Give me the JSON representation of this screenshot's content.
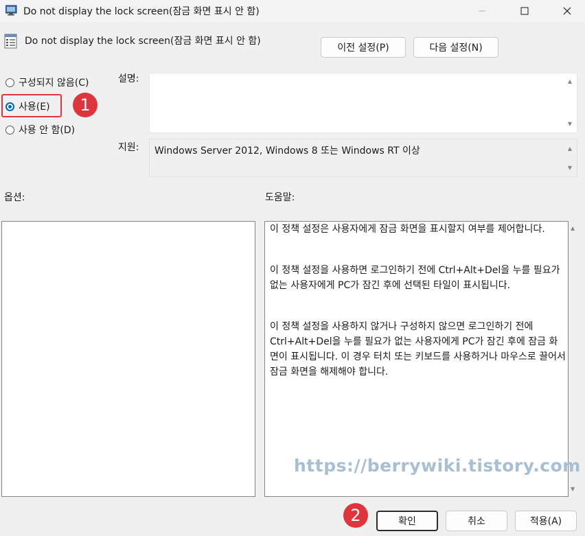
{
  "window": {
    "title": "Do not display the lock screen(잠금 화면 표시 안 함)",
    "controls": [
      "minimize-icon",
      "maximize-icon",
      "close-icon"
    ]
  },
  "header": {
    "policy_name": "Do not display the lock screen(잠금 화면 표시 안 함)",
    "prev_button": "이전 설정(P)",
    "next_button": "다음 설정(N)"
  },
  "state": {
    "options": [
      {
        "label": "구성되지 않음(C)",
        "checked": false
      },
      {
        "label": "사용(E)",
        "checked": true
      },
      {
        "label": "사용 안 함(D)",
        "checked": false
      }
    ]
  },
  "comment": {
    "label": "설명:",
    "value": ""
  },
  "support": {
    "label": "지원:",
    "value": "Windows Server 2012, Windows 8 또는 Windows RT 이상"
  },
  "options_pane": {
    "label": "옵션:"
  },
  "help_pane": {
    "label": "도움말:",
    "paragraphs": [
      "이 정책 설정은 사용자에게 잠금 화면을 표시할지 여부를 제어합니다.",
      "이 정책 설정을 사용하면 로그인하기 전에 Ctrl+Alt+Del을 누를 필요가 없는 사용자에게 PC가 잠긴 후에 선택된 타일이 표시됩니다.",
      "이 정책 설정을 사용하지 않거나 구성하지 않으면 로그인하기 전에 Ctrl+Alt+Del을 누를 필요가 없는 사용자에게 PC가 잠긴 후에 잠금 화면이 표시됩니다. 이 경우 터치 또는 키보드를 사용하거나 마우스로 끌어서 잠금 화면을 해제해야 합니다."
    ]
  },
  "footer": {
    "ok": "확인",
    "cancel": "취소",
    "apply": "적용(A)"
  },
  "annotations": {
    "step1": "1",
    "step2": "2",
    "watermark": "https://berrywiki.tistory.com"
  },
  "colors": {
    "highlight": "#e0343d",
    "radio_accent": "#0067c0",
    "watermark": "#a7bfd2"
  }
}
